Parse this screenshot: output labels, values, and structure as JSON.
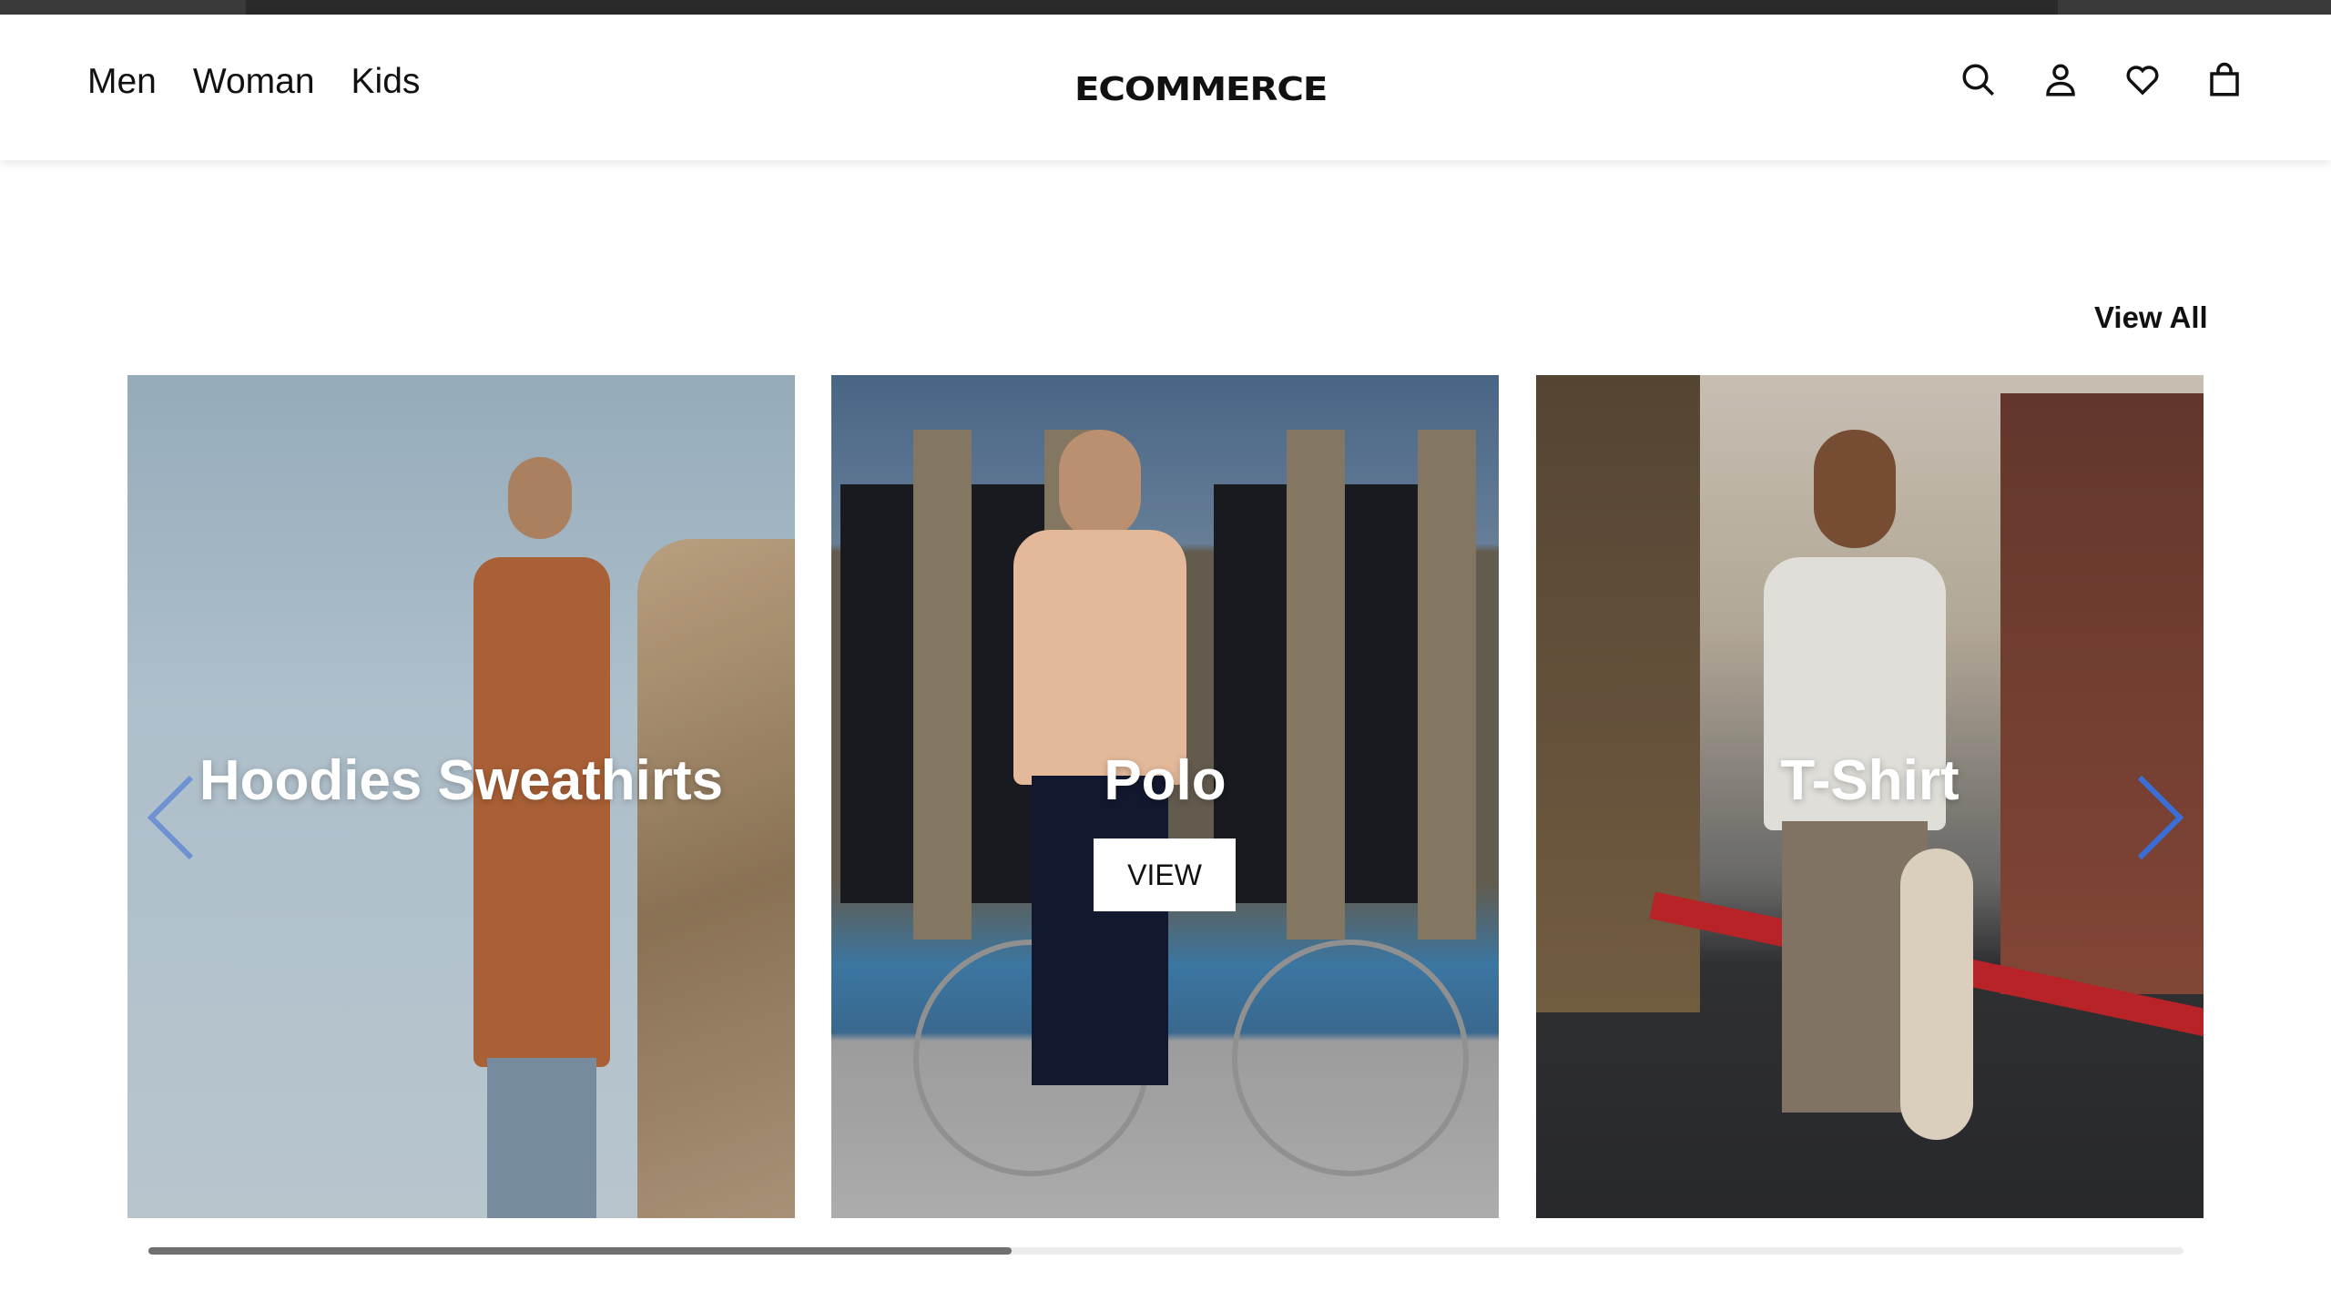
{
  "header": {
    "nav": [
      {
        "label": "Men"
      },
      {
        "label": "Woman"
      },
      {
        "label": "Kids"
      }
    ],
    "logo": "eCOMMERCE",
    "icons": [
      "search-icon",
      "user-icon",
      "heart-icon",
      "bag-icon"
    ]
  },
  "section": {
    "view_all": "View All"
  },
  "carousel": {
    "cards": [
      {
        "title": "Hoodies Sweathirts"
      },
      {
        "title": "Polo",
        "button": "VIEW"
      },
      {
        "title": "T-Shirt"
      }
    ],
    "scroll_progress": 0.424
  },
  "colors": {
    "arrow": "#3a6fd8",
    "text": "#111111"
  }
}
